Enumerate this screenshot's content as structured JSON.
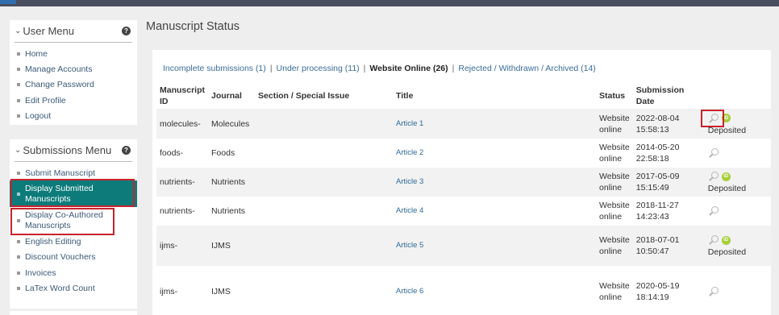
{
  "user_menu": {
    "title": "User Menu",
    "items": [
      "Home",
      "Manage Accounts",
      "Change Password",
      "Edit Profile",
      "Logout"
    ]
  },
  "submissions_menu": {
    "title": "Submissions Menu",
    "items": [
      "Submit Manuscript",
      "Display Submitted Manuscripts",
      "Display Co-Authored Manuscripts",
      "English Editing",
      "Discount Vouchers",
      "Invoices",
      "LaTex Word Count"
    ]
  },
  "page_title": "Manuscript Status",
  "tabs": [
    {
      "label": "Incomplete submissions (1)"
    },
    {
      "label": "Under processing (11)"
    },
    {
      "label": "Website Online (26)"
    },
    {
      "label": "Rejected / Withdrawn / Archived (14)"
    }
  ],
  "table": {
    "headers": {
      "id": "Manuscript ID",
      "journal": "Journal",
      "section": "Section / Special Issue",
      "title": "Title",
      "status": "Status",
      "date": "Submission Date"
    },
    "rows": [
      {
        "id": "molecules-",
        "journal": "Molecules",
        "section": "",
        "title": "Article 1",
        "status": "Website online",
        "date": "2022-08-04 15:58:13",
        "deposited": "Deposited"
      },
      {
        "id": "foods-",
        "journal": "Foods",
        "section": "",
        "title": "Article 2",
        "status": "Website online",
        "date": "2014-05-20 22:58:18",
        "deposited": ""
      },
      {
        "id": "nutrients-",
        "journal": "Nutrients",
        "section": "",
        "title": "Article 3",
        "status": "Website online",
        "date": "2017-05-09 15:15:49",
        "deposited": "Deposited"
      },
      {
        "id": "nutrients-",
        "journal": "Nutrients",
        "section": "",
        "title": "Article 4",
        "status": "Website online",
        "date": "2018-11-27 14:23:43",
        "deposited": ""
      },
      {
        "id": "ijms-",
        "journal": "IJMS",
        "section": "",
        "title": "Article 5",
        "status": "Website online",
        "date": "2018-07-01 10:50:47",
        "deposited": "Deposited"
      },
      {
        "id": "ijms-",
        "journal": "IJMS",
        "section": "",
        "title": "Article 6",
        "status": "Website online",
        "date": "2020-05-19 18:14:19",
        "deposited": ""
      }
    ]
  },
  "icons": {
    "help": "?",
    "chevron": "⌄",
    "orcid": "iD"
  },
  "colors": {
    "active_menu": "#0c7b7a",
    "highlight_frame": "#c8232c",
    "link": "#3a6d9a"
  }
}
